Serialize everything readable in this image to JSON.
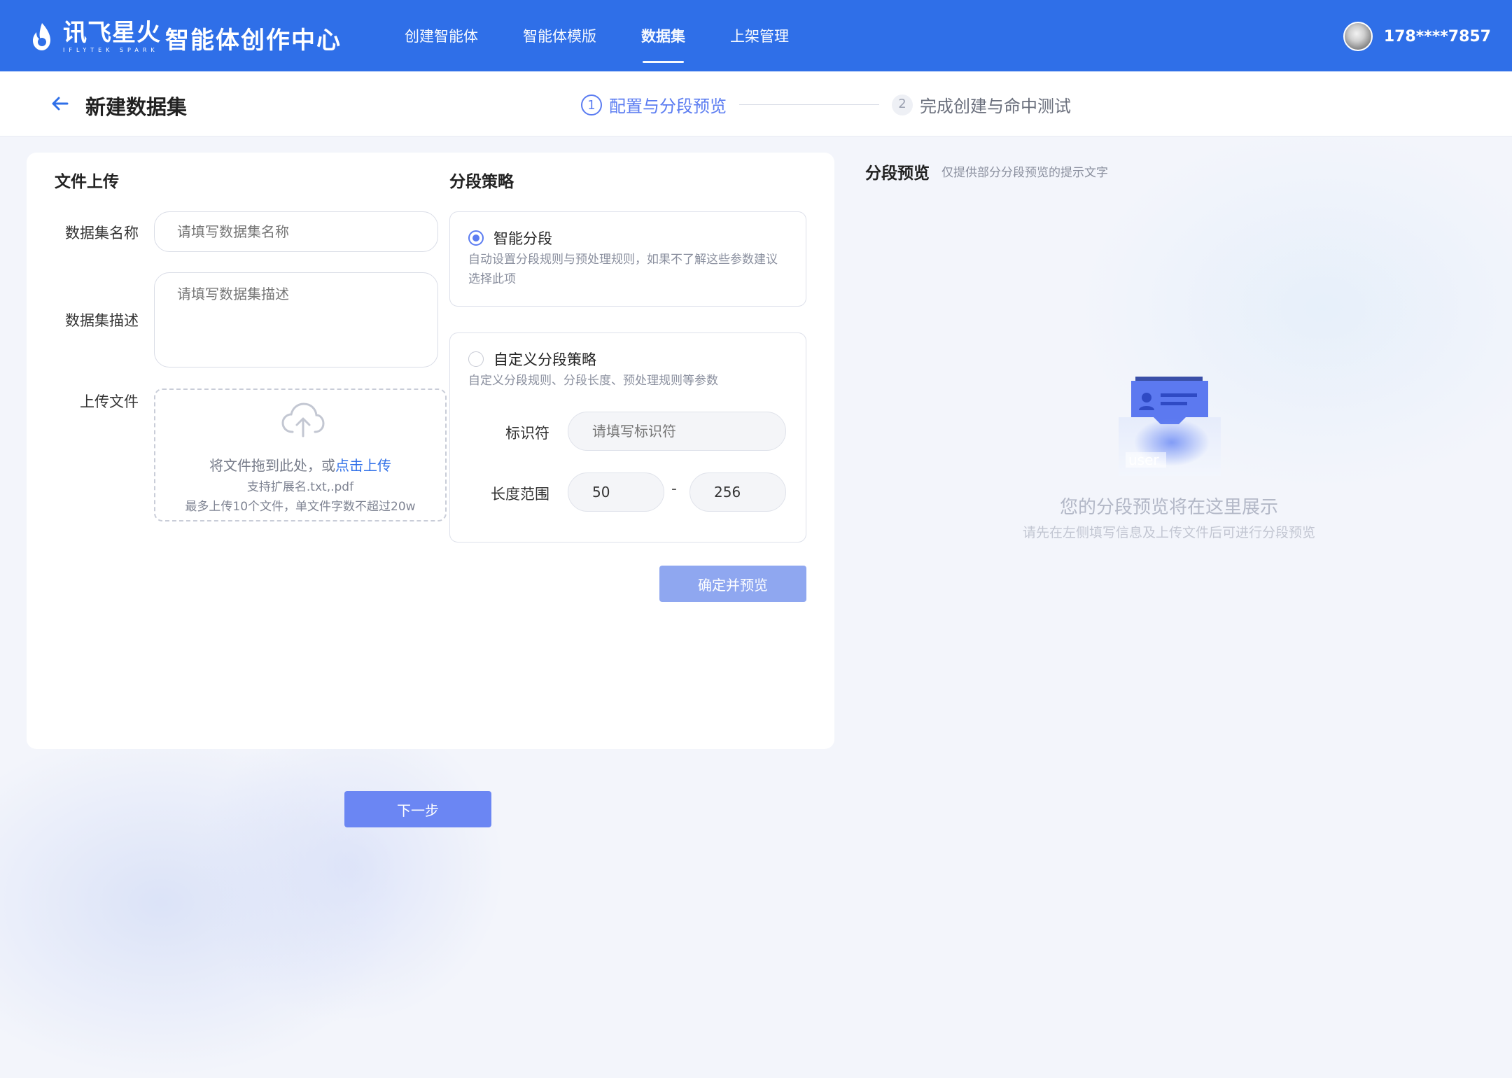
{
  "topbar": {
    "logo_cn": "讯飞星火",
    "logo_en": "IFLYTEK SPARK",
    "app_title": "智能体创作中心",
    "nav": [
      {
        "label": "创建智能体",
        "active": false
      },
      {
        "label": "智能体模版",
        "active": false
      },
      {
        "label": "数据集",
        "active": true
      },
      {
        "label": "上架管理",
        "active": false
      }
    ],
    "user_phone": "178****7857"
  },
  "subheader": {
    "title": "新建数据集",
    "steps": [
      {
        "num": "1",
        "label": "配置与分段预览",
        "state": "current"
      },
      {
        "num": "2",
        "label": "完成创建与命中测试",
        "state": "pending"
      }
    ]
  },
  "upload_section": {
    "title": "文件上传",
    "name_label": "数据集名称",
    "name_placeholder": "请填写数据集名称",
    "desc_label": "数据集描述",
    "desc_placeholder": "请填写数据集描述",
    "file_label": "上传文件",
    "drop_text": "将文件拖到此处，或",
    "drop_link": "点击上传",
    "ext_text": "支持扩展名.txt,.pdf",
    "limit_text": "最多上传10个文件，单文件字数不超过20w"
  },
  "strategy_section": {
    "title": "分段策略",
    "smart": {
      "title": "智能分段",
      "desc": "自动设置分段规则与预处理规则，如果不了解这些参数建议选择此项",
      "selected": true
    },
    "custom": {
      "title": "自定义分段策略",
      "desc": "自定义分段规则、分段长度、预处理规则等参数",
      "selected": false,
      "separator_label": "标识符",
      "separator_placeholder": "请填写标识符",
      "length_label": "长度范围",
      "length_min": "50",
      "length_sep": "-",
      "length_max": "256"
    },
    "confirm_button": "确定并预览"
  },
  "next_button": "下一步",
  "preview": {
    "title": "分段预览",
    "hint": "仅提供部分分段预览的提示文字",
    "illus_label": "user",
    "empty_title": "您的分段预览将在这里展示",
    "empty_sub": "请先在左侧填写信息及上传文件后可进行分段预览"
  },
  "colors": {
    "primary": "#2f6fe8",
    "accent": "#5b7cf1",
    "confirm_disabled": "#8fa7f0",
    "next_button": "#6b86f3"
  }
}
